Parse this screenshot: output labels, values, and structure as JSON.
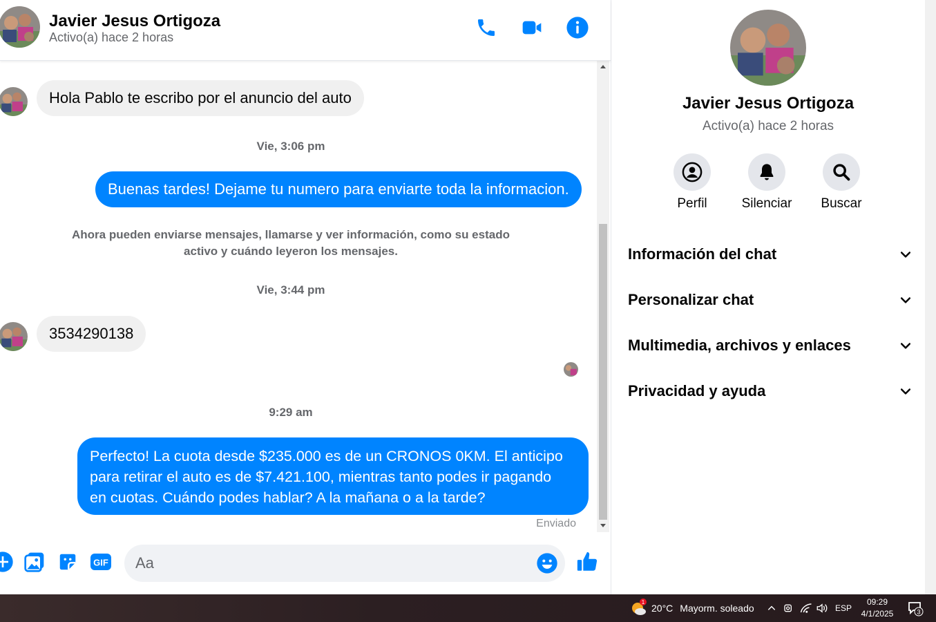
{
  "contact": {
    "name": "Javier Jesus Ortigoza",
    "status": "Activo(a) hace 2 horas"
  },
  "header": {
    "call_icon": "phone-icon",
    "video_icon": "video-camera-icon",
    "info_icon": "info-icon"
  },
  "messages": {
    "m1": "Hola Pablo te escribo por el anuncio  del auto",
    "ts1": "Vie, 3:06 pm",
    "m2": "Buenas tardes! Dejame tu numero para enviarte toda la informacion.",
    "sys_line1": "Ahora pueden enviarse mensajes, llamarse y ver información, como su estado",
    "sys_line2": "activo y cuándo leyeron los mensajes.",
    "ts2": "Vie, 3:44 pm",
    "m3": "3534290138",
    "ts3": "9:29 am",
    "m4_line1": "Perfecto! La cuota desde $235.000 es de un CRONOS 0KM. El anticipo",
    "m4_line2": "para retirar el auto es de $7.421.100, mientras tanto podes ir pagando",
    "m4_line3": "en cuotas. Cuándo podes hablar? A la mañana o a la tarde?",
    "sent_status": "Enviado"
  },
  "composer": {
    "placeholder": "Aa",
    "gif_label": "GIF"
  },
  "panel": {
    "actions": [
      {
        "label": "Perfil",
        "icon": "profile-icon"
      },
      {
        "label": "Silenciar",
        "icon": "bell-icon"
      },
      {
        "label": "Buscar",
        "icon": "search-icon"
      }
    ],
    "sections": [
      "Información del chat",
      "Personalizar chat",
      "Multimedia, archivos y enlaces",
      "Privacidad y ayuda"
    ]
  },
  "taskbar": {
    "weather_badge": "1",
    "temperature": "20°C",
    "weather": "Mayorm. soleado",
    "language": "ESP",
    "time": "09:29",
    "date": "4/1/2025",
    "notifications": "3"
  },
  "colors": {
    "accent": "#0084ff",
    "bubble_in": "#f0f0f0",
    "secondary_text": "#65676b"
  }
}
